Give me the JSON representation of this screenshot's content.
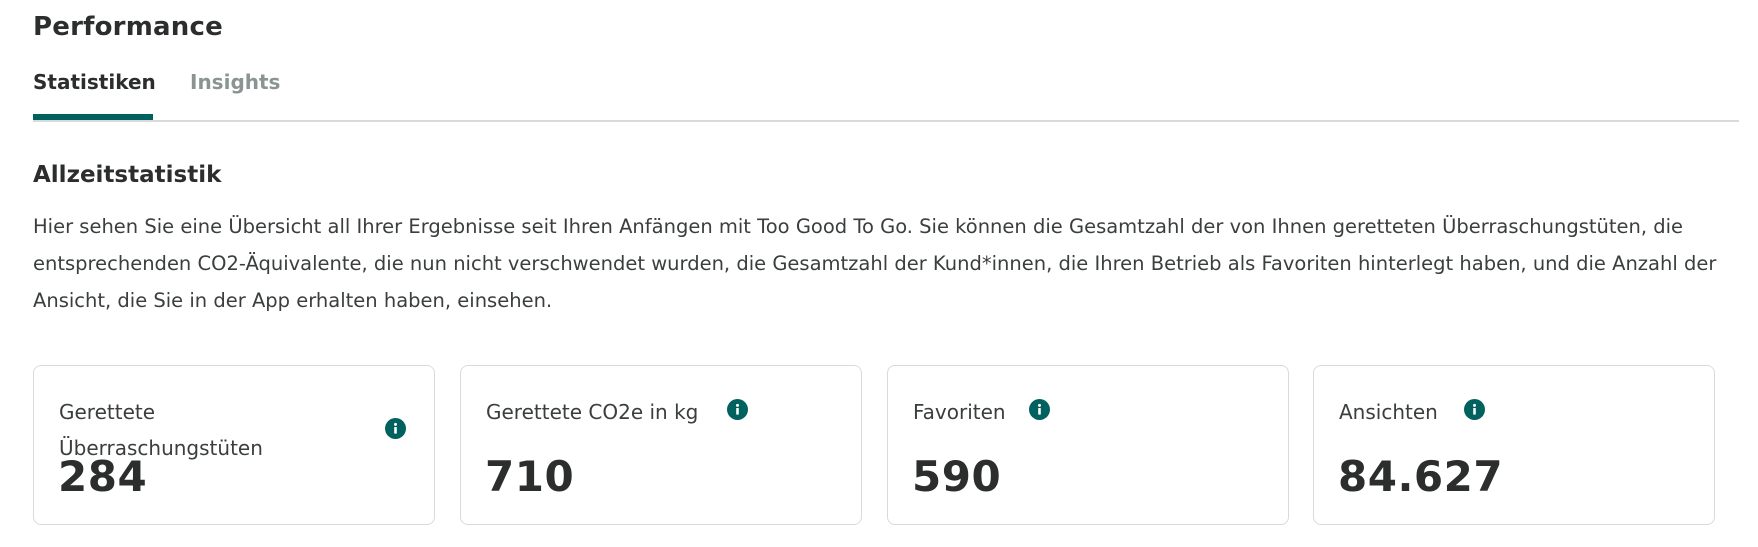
{
  "header": {
    "title": "Performance"
  },
  "tabs": [
    {
      "label": "Statistiken",
      "active": true
    },
    {
      "label": "Insights",
      "active": false
    }
  ],
  "section": {
    "title": "Allzeitstatistik",
    "description": "Hier sehen Sie eine Übersicht all Ihrer Ergebnisse seit Ihren Anfängen mit Too Good To Go. Sie können die Gesamtzahl der von Ihnen geretteten Überraschungstüten, die entsprechenden CO2-Äquivalente, die nun nicht verschwendet wurden, die Gesamtzahl der Kund*innen, die Ihren Betrieb als Favoriten hinterlegt haben, und die Anzahl der Ansicht, die Sie in der App erhalten haben, einsehen."
  },
  "stats": [
    {
      "label": "Gerettete Überraschungstüten",
      "value": "284",
      "icon": "info-icon"
    },
    {
      "label": "Gerettete CO2e in kg",
      "value": "710",
      "icon": "info-icon"
    },
    {
      "label": "Favoriten",
      "value": "590",
      "icon": "info-icon"
    },
    {
      "label": "Ansichten",
      "value": "84.627",
      "icon": "info-icon"
    }
  ],
  "colors": {
    "accent": "#00615f",
    "text": "#2b2e2d",
    "muted": "#8a9593",
    "border": "#d7dcdb"
  }
}
